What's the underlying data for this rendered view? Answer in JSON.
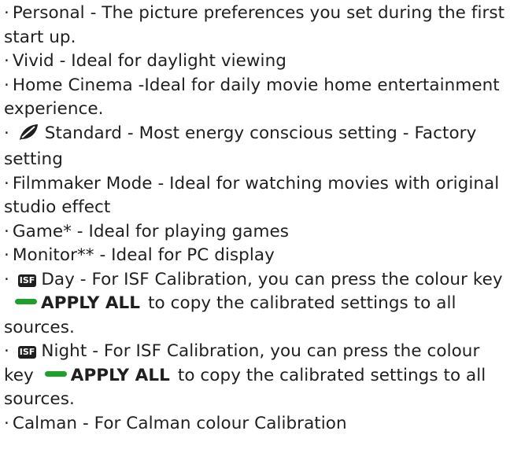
{
  "items": [
    {
      "bullet": "·",
      "text": "Personal - The picture preferences you set during the first start up."
    },
    {
      "bullet": "·",
      "text": "Vivid - Ideal for daylight viewing"
    },
    {
      "bullet": "·",
      "text": "Home Cinema -Ideal for daily movie home entertainment experience."
    },
    {
      "bullet": "·",
      "icon": "leaf-icon",
      "text": "Standard - Most energy conscious setting - Factory setting"
    },
    {
      "bullet": "·",
      "text": "Filmmaker Mode - Ideal for watching movies with original studio effect"
    },
    {
      "bullet": "·",
      "text": "Game* - Ideal for playing games"
    },
    {
      "bullet": "·",
      "text": "Monitor** - Ideal for PC display"
    },
    {
      "bullet": "·",
      "badge": "ISF",
      "text_before": "Day - For ISF Calibration, you can press the colour key",
      "key_label": "APPLY ALL",
      "text_after": "to copy the calibrated settings to all sources."
    },
    {
      "bullet": "·",
      "badge": "ISF",
      "text_before": "Night - For ISF Calibration, you can press the colour key",
      "key_label": "APPLY ALL",
      "text_after": "to copy the calibrated settings to all sources."
    },
    {
      "bullet": "·",
      "text": "Calman - For Calman colour Calibration"
    }
  ],
  "colors": {
    "text": "#1f1f1f",
    "green_key": "#1fa02b",
    "background": "#ffffff"
  }
}
